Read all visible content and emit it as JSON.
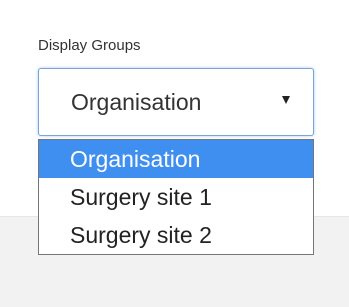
{
  "display_groups": {
    "label": "Display Groups",
    "selected_value": "Organisation",
    "caret_icon": "chevron-down-icon",
    "options": [
      {
        "label": "Organisation",
        "selected": true
      },
      {
        "label": "Surgery site 1",
        "selected": false
      },
      {
        "label": "Surgery site 2",
        "selected": false
      }
    ]
  },
  "colors": {
    "highlight": "#3f8ff0",
    "highlight_text": "#ffffff",
    "select_border": "#7aa4d8",
    "page_background": "#f2f2f2",
    "panel_background": "#ffffff"
  }
}
